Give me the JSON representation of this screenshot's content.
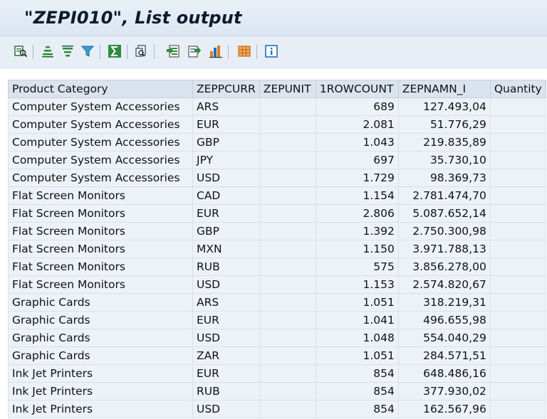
{
  "title": "\"ZEPI010\", List output",
  "toolbar": {
    "buttons": [
      {
        "name": "details-icon",
        "color": "#2f6e3a"
      },
      {
        "name": "sort-ascending-icon",
        "color": "#2f8a3e"
      },
      {
        "name": "sort-descending-icon",
        "color": "#2f8a3e"
      },
      {
        "name": "filter-icon",
        "color": "#2a7fb0"
      },
      {
        "name": "total-icon",
        "color": "#2f8a3e"
      },
      {
        "name": "print-preview-icon",
        "color": "#3a5f86"
      },
      {
        "name": "export-spreadsheet-icon",
        "color": "#2f8a3e"
      },
      {
        "name": "export-local-file-icon",
        "color": "#2f8a3e"
      },
      {
        "name": "graphic-icon",
        "color": "#e07a1f"
      },
      {
        "name": "layout-icon",
        "color": "#e07a1f"
      },
      {
        "name": "info-icon",
        "color": "#1f6fb5"
      }
    ]
  },
  "table": {
    "columns": [
      "Product Category",
      "ZEPPCURR",
      "ZEPUNIT",
      "1ROWCOUNT",
      "ZEPNAMN_I",
      "Quantity"
    ],
    "rows": [
      [
        "Computer System Accessories",
        "ARS",
        "",
        "689",
        "127.493,04",
        ""
      ],
      [
        "Computer System Accessories",
        "EUR",
        "",
        "2.081",
        "51.776,29",
        ""
      ],
      [
        "Computer System Accessories",
        "GBP",
        "",
        "1.043",
        "219.835,89",
        ""
      ],
      [
        "Computer System Accessories",
        "JPY",
        "",
        "697",
        "35.730,10",
        ""
      ],
      [
        "Computer System Accessories",
        "USD",
        "",
        "1.729",
        "98.369,73",
        ""
      ],
      [
        "Flat Screen Monitors",
        "CAD",
        "",
        "1.154",
        "2.781.474,70",
        ""
      ],
      [
        "Flat Screen Monitors",
        "EUR",
        "",
        "2.806",
        "5.087.652,14",
        ""
      ],
      [
        "Flat Screen Monitors",
        "GBP",
        "",
        "1.392",
        "2.750.300,98",
        ""
      ],
      [
        "Flat Screen Monitors",
        "MXN",
        "",
        "1.150",
        "3.971.788,13",
        ""
      ],
      [
        "Flat Screen Monitors",
        "RUB",
        "",
        "575",
        "3.856.278,00",
        ""
      ],
      [
        "Flat Screen Monitors",
        "USD",
        "",
        "1.153",
        "2.574.820,67",
        ""
      ],
      [
        "Graphic Cards",
        "ARS",
        "",
        "1.051",
        "318.219,31",
        ""
      ],
      [
        "Graphic Cards",
        "EUR",
        "",
        "1.041",
        "496.655,98",
        ""
      ],
      [
        "Graphic Cards",
        "USD",
        "",
        "1.048",
        "554.040,29",
        ""
      ],
      [
        "Graphic Cards",
        "ZAR",
        "",
        "1.051",
        "284.571,51",
        ""
      ],
      [
        "Ink Jet Printers",
        "EUR",
        "",
        "854",
        "648.486,16",
        ""
      ],
      [
        "Ink Jet Printers",
        "RUB",
        "",
        "854",
        "377.930,02",
        ""
      ],
      [
        "Ink Jet Printers",
        "USD",
        "",
        "854",
        "162.567,96",
        ""
      ]
    ]
  }
}
